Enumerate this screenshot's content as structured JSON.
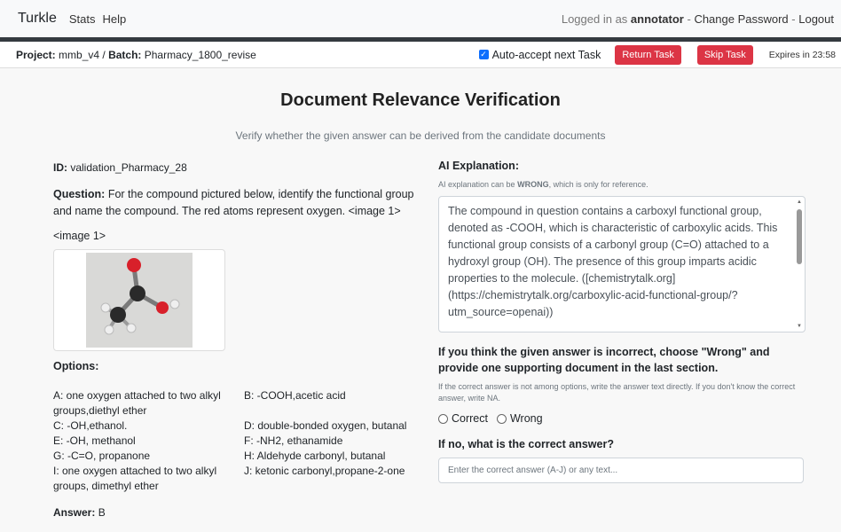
{
  "navbar": {
    "brand": "Turkle",
    "links": [
      "Stats",
      "Help"
    ],
    "logged_prefix": "Logged in as ",
    "username": "annotator",
    "sep1": " - ",
    "change_password": "Change Password",
    "sep2": " - ",
    "logout": "Logout"
  },
  "taskbar": {
    "project_label": "Project:",
    "project": "mmb_v4",
    "slash": " / ",
    "batch_label": "Batch:",
    "batch": "Pharmacy_1800_revise",
    "auto_accept": "Auto-accept next Task",
    "auto_accept_checked": true,
    "return_task": "Return Task",
    "skip_task": "Skip Task",
    "expires": "Expires in 23:58"
  },
  "page": {
    "title": "Document Relevance Verification",
    "subtitle": "Verify whether the given answer can be derived from the candidate documents"
  },
  "left": {
    "id_label": "ID:",
    "id": "validation_Pharmacy_28",
    "question_label": "Question:",
    "question": "For the compound pictured below, identify the functional group and name the compound. The red atoms represent oxygen. <image 1>",
    "image_ref": "<image 1>",
    "options_label": "Options:",
    "options": [
      "A: one oxygen attached to two alkyl groups,diethyl ether",
      "B: -COOH,acetic acid",
      "C: -OH,ethanol.",
      "D: double-bonded oxygen, butanal",
      "E: -OH, methanol",
      "F: -NH2, ethanamide",
      "G: -C=O, propanone",
      "H: Aldehyde carbonyl, butanal",
      "I: one oxygen attached to two alkyl groups, dimethyl ether",
      "J: ketonic carbonyl,propane-2-one"
    ],
    "answer_label": "Answer:",
    "answer": "B"
  },
  "right": {
    "ai_label": "AI Explanation:",
    "ai_note_pre": "AI explanation can be ",
    "ai_note_bold": "WRONG",
    "ai_note_post": ", which is only for reference.",
    "ai_text": "The compound in question contains a carboxyl functional group, denoted as -COOH, which is characteristic of carboxylic acids. This functional group consists of a carbonyl group (C=O) attached to a hydroxyl group (OH). The presence of this group imparts acidic properties to the molecule. ([chemistrytalk.org](https://chemistrytalk.org/carboxylic-acid-functional-group/?utm_source=openai))",
    "wrong_heading": "If you think the given answer is incorrect, choose \"Wrong\" and provide one supporting document in the last section.",
    "wrong_note": "If the correct answer is not among options, write the answer text directly. If you don't know the correct answer, write NA.",
    "radio_correct": "Correct",
    "radio_wrong": "Wrong",
    "no_heading": "If no, what is the correct answer?",
    "answer_placeholder": "Enter the correct answer (A-J) or any text..."
  }
}
